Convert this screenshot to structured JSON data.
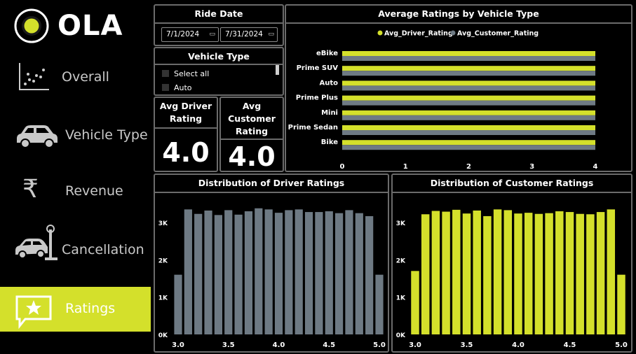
{
  "app": {
    "logo_text": "OLA"
  },
  "sidebar": {
    "items": [
      {
        "label": "Overall",
        "icon": "scatter-chart-icon"
      },
      {
        "label": "Vehicle Type",
        "icon": "car-icon"
      },
      {
        "label": "Revenue",
        "icon": "rupee-icon"
      },
      {
        "label": "Cancellation",
        "icon": "car-crash-icon"
      },
      {
        "label": "Ratings",
        "icon": "star-message-icon",
        "active": true
      }
    ]
  },
  "ride_date": {
    "title": "Ride Date",
    "start": "7/1/2024",
    "end": "7/31/2024"
  },
  "vehicle_filter": {
    "title": "Vehicle Type",
    "options": [
      "Select all",
      "Auto"
    ]
  },
  "kpis": {
    "driver": {
      "title_line1": "Avg Driver",
      "title_line2": "Rating",
      "value": "4.0"
    },
    "customer": {
      "title_line1": "Avg",
      "title_line2": "Customer",
      "title_line3": "Rating",
      "value": "4.0"
    }
  },
  "colors": {
    "accent": "#d4e02b",
    "gray_bar": "#6e7a84",
    "border": "#6b6b6b"
  },
  "chart_data": [
    {
      "type": "bar",
      "orientation": "horizontal",
      "title": "Average Ratings by Vehicle Type",
      "categories": [
        "eBike",
        "Prime SUV",
        "Auto",
        "Prime Plus",
        "Mini",
        "Prime Sedan",
        "Bike"
      ],
      "series": [
        {
          "name": "Avg_Driver_Rating",
          "color": "#d4e02b",
          "values": [
            4.0,
            4.0,
            4.0,
            4.0,
            4.0,
            4.0,
            4.0
          ]
        },
        {
          "name": "Avg_Customer_Rating",
          "color": "#6e7a84",
          "values": [
            4.0,
            4.0,
            4.0,
            4.0,
            4.0,
            4.0,
            4.0
          ]
        }
      ],
      "xticks": [
        "0",
        "1",
        "2",
        "3",
        "4"
      ],
      "xlim": [
        0,
        4
      ],
      "legend": "top-center"
    },
    {
      "type": "bar",
      "title": "Distribution of Driver Ratings",
      "color": "#6e7a84",
      "x": [
        3.0,
        3.1,
        3.2,
        3.3,
        3.4,
        3.5,
        3.6,
        3.7,
        3.8,
        3.9,
        4.0,
        4.1,
        4.2,
        4.3,
        4.4,
        4.5,
        4.6,
        4.7,
        4.8,
        4.9,
        5.0
      ],
      "values": [
        1600,
        3350,
        3230,
        3320,
        3200,
        3330,
        3210,
        3300,
        3380,
        3350,
        3260,
        3330,
        3350,
        3280,
        3280,
        3300,
        3250,
        3330,
        3250,
        3170,
        1600
      ],
      "yticks": [
        "0K",
        "1K",
        "2K",
        "3K"
      ],
      "xticks": [
        "3.0",
        "3.5",
        "4.0",
        "4.5",
        "5.0"
      ],
      "ylim": [
        0,
        3600
      ]
    },
    {
      "type": "bar",
      "title": "Distribution of Customer Ratings",
      "color": "#d4e02b",
      "x": [
        3.0,
        3.1,
        3.2,
        3.3,
        3.4,
        3.5,
        3.6,
        3.7,
        3.8,
        3.9,
        4.0,
        4.1,
        4.2,
        4.3,
        4.4,
        4.5,
        4.6,
        4.7,
        4.8,
        4.9,
        5.0
      ],
      "values": [
        1700,
        3220,
        3310,
        3290,
        3340,
        3240,
        3320,
        3170,
        3350,
        3330,
        3240,
        3260,
        3230,
        3250,
        3300,
        3280,
        3230,
        3220,
        3280,
        3350,
        1600
      ],
      "yticks": [
        "0K",
        "1K",
        "2K",
        "3K"
      ],
      "xticks": [
        "3.0",
        "3.5",
        "4.0",
        "4.5",
        "5.0"
      ],
      "ylim": [
        0,
        3600
      ]
    }
  ]
}
